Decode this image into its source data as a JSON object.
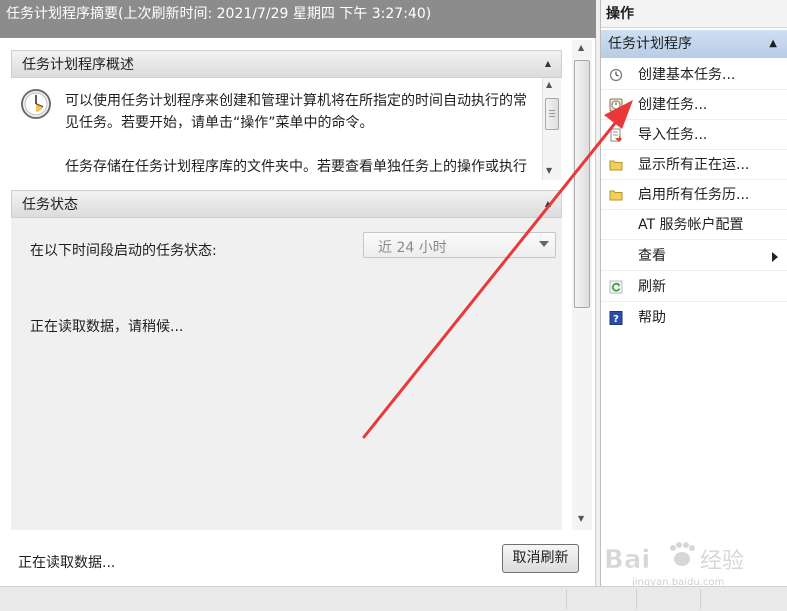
{
  "header": {
    "summary_title": "任务计划程序摘要(上次刷新时间: 2021/7/29 星期四 下午 3:27:40)"
  },
  "overview": {
    "title": "任务计划程序概述",
    "paragraph1": "可以使用任务计划程序来创建和管理计算机将在所指定的时间自动执行的常见任务。若要开始，请单击“操作”菜单中的命令。",
    "paragraph2": "任务存储在任务计划程序库的文件夹中。若要查看单独任务上的操作或执行该操作，请在任务计划程序库中选择该任务，然后在“操作”"
  },
  "status": {
    "title": "任务状态",
    "period_label": "在以下时间段启动的任务状态:",
    "period_value": "近 24 小时",
    "loading_text": "正在读取数据，请稍候..."
  },
  "footer": {
    "status_text": "正在读取数据...",
    "cancel_refresh_label": "取消刷新"
  },
  "actions": {
    "title": "操作",
    "group_label": "任务计划程序",
    "items": [
      {
        "label": "创建基本任务...",
        "icon": "create-basic-task-icon"
      },
      {
        "label": "创建任务...",
        "icon": "create-task-icon"
      },
      {
        "label": "导入任务...",
        "icon": "import-task-icon"
      },
      {
        "label": "显示所有正在运...",
        "icon": "folder-icon"
      },
      {
        "label": "启用所有任务历...",
        "icon": "folder-icon"
      },
      {
        "label": "AT 服务帐户配置",
        "icon": ""
      },
      {
        "label": "查看",
        "icon": "",
        "submenu": true
      },
      {
        "label": "刷新",
        "icon": "refresh-icon"
      },
      {
        "label": "帮助",
        "icon": "help-icon"
      }
    ]
  },
  "watermark": {
    "brand_text": "Bai",
    "brand_text2": "经验",
    "url": "jingyan.baidu.com"
  },
  "colors": {
    "header_bg": "#8c8c8c",
    "annotation_arrow": "#e8383a",
    "group_highlight": "#c3d6ee"
  }
}
